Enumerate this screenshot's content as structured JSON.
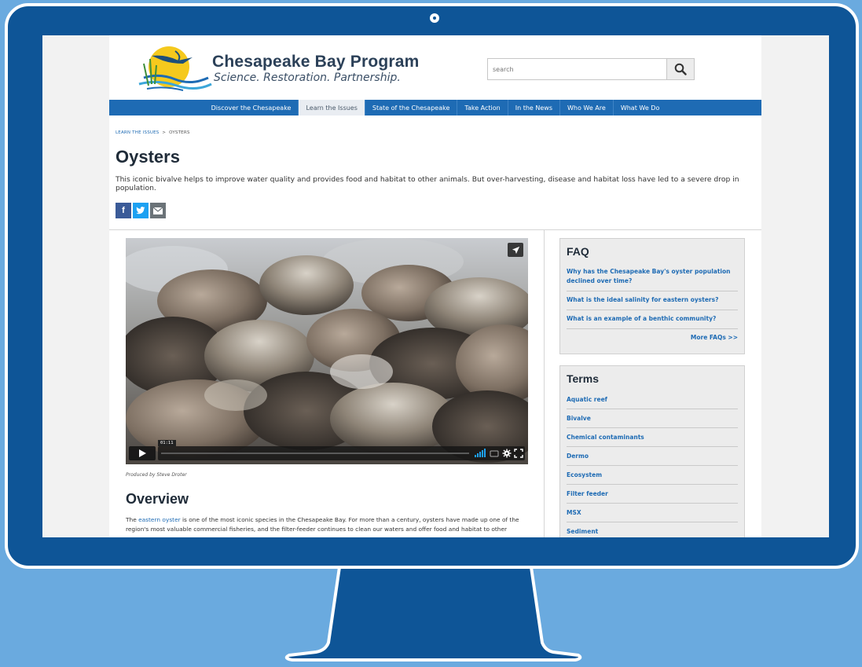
{
  "site": {
    "title": "Chesapeake Bay Program",
    "tagline": "Science. Restoration. Partnership."
  },
  "search": {
    "placeholder": "search"
  },
  "nav": {
    "items": [
      {
        "label": "Discover the Chesapeake"
      },
      {
        "label": "Learn the Issues"
      },
      {
        "label": "State of the Chesapeake"
      },
      {
        "label": "Take Action"
      },
      {
        "label": "In the News"
      },
      {
        "label": "Who We Are"
      },
      {
        "label": "What We Do"
      }
    ],
    "active_index": 1
  },
  "breadcrumb": {
    "parent": "LEARN THE ISSUES",
    "separator": ">",
    "current": "OYSTERS"
  },
  "page": {
    "title": "Oysters",
    "intro": "This iconic bivalve helps to improve water quality and provides food and habitat to other animals. But over-harvesting, disease and habitat loss have led to a severe drop in population."
  },
  "share": {
    "facebook": "f",
    "twitter_icon": "twitter-bird",
    "email_icon": "envelope"
  },
  "video": {
    "time": "01:11",
    "caption": "Produced by Steve Droter"
  },
  "overview": {
    "title": "Overview",
    "text_before": "The ",
    "link": "eastern oyster",
    "text_after": " is one of the most iconic species in the Chesapeake Bay. For more than a century, oysters have made up one of the region's most valuable commercial fisheries, and the filter-feeder continues to clean our waters and offer food and habitat to other"
  },
  "faq": {
    "title": "FAQ",
    "items": [
      {
        "label": "Why has the Chesapeake Bay's oyster population declined over time?"
      },
      {
        "label": "What is the ideal salinity for eastern oysters?"
      },
      {
        "label": "What is an example of a benthic community?"
      }
    ],
    "more": "More FAQs >>"
  },
  "terms": {
    "title": "Terms",
    "items": [
      {
        "label": "Aquatic reef"
      },
      {
        "label": "Bivalve"
      },
      {
        "label": "Chemical contaminants"
      },
      {
        "label": "Dermo"
      },
      {
        "label": "Ecosystem"
      },
      {
        "label": "Filter feeder"
      },
      {
        "label": "MSX"
      },
      {
        "label": "Sediment"
      }
    ]
  },
  "colors": {
    "background": "#6aaadf",
    "bezel": "#0e5597",
    "nav": "#1e6bb4",
    "link": "#1e6bb4",
    "heading": "#1f2b38"
  }
}
